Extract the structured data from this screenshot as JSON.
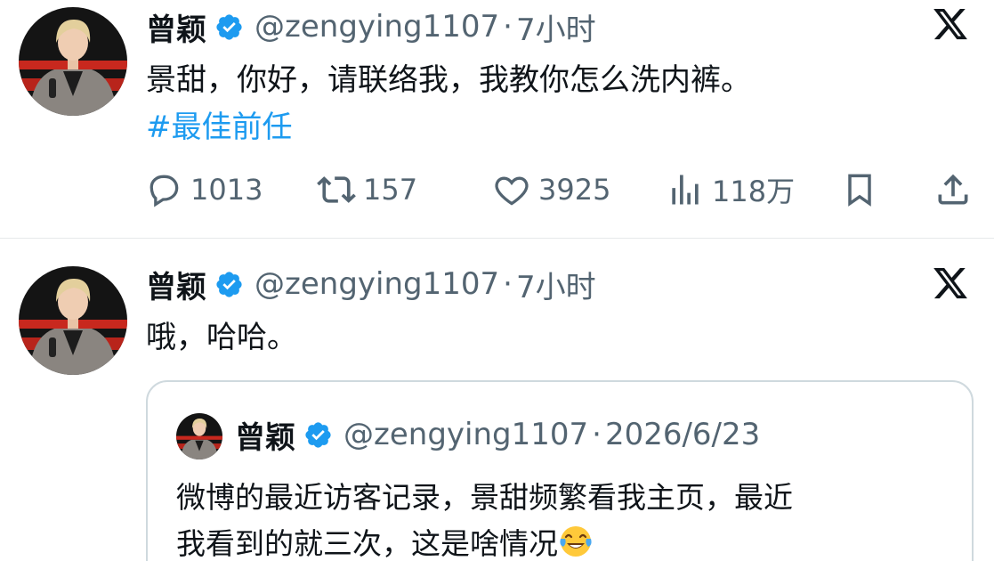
{
  "tweets": [
    {
      "author_name": "曾颖",
      "handle": "@zengying1107",
      "separator": "·",
      "time": "7小时",
      "text": "景甜，你好，请联络我，我教你怎么洗内裤。",
      "hashtag": "#最佳前任",
      "actions": {
        "reply_count": "1013",
        "retweet_count": "157",
        "like_count": "3925",
        "view_count": "118万"
      }
    },
    {
      "author_name": "曾颖",
      "handle": "@zengying1107",
      "separator": "·",
      "time": "7小时",
      "text": "哦，哈哈。",
      "quote": {
        "author_name": "曾颖",
        "handle": "@zengying1107",
        "separator": "·",
        "date": "2026/6/23",
        "text_line1": "微博的最近访客记录，景甜频繁看我主页，最近",
        "text_line2": "我看到的就三次，这是啥情况",
        "emoji": "face-with-tears-of-joy"
      }
    }
  ],
  "icons": {
    "verified": "verified-badge-icon",
    "platform": "x-logo-icon",
    "reply": "reply-icon",
    "retweet": "retweet-icon",
    "like": "like-icon",
    "views": "views-icon",
    "bookmark": "bookmark-icon",
    "share": "share-icon"
  },
  "colors": {
    "verified_blue": "#1d9bf0",
    "hashtag_blue": "#1d9bf0",
    "secondary_text": "#536471",
    "primary_text": "#0f1419",
    "divider": "#e6e9eb",
    "quote_border": "#cfd9de"
  }
}
